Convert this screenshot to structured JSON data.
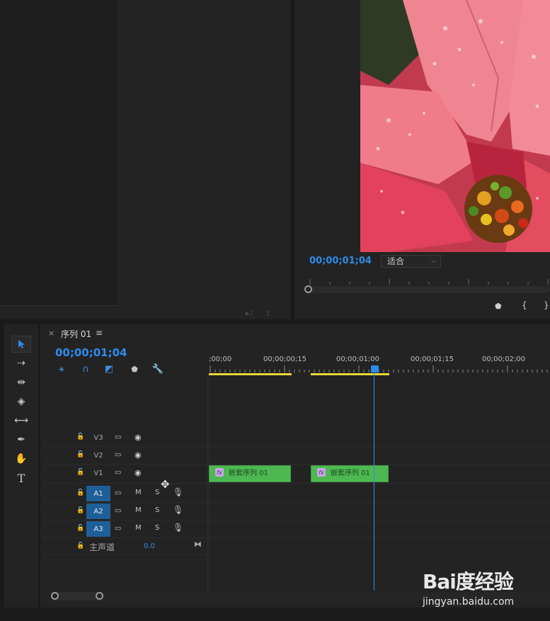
{
  "program_monitor": {
    "timecode": "00;00;01;04",
    "fit_select": {
      "value": "适合"
    }
  },
  "timeline": {
    "tab_title": "序列 01",
    "timecode": "00;00;01;04",
    "ruler_labels": [
      ";00;00",
      "00;00;00;15",
      "00;00;01;00",
      "00;00;01;15",
      "00;00;02;00"
    ],
    "video_tracks": [
      {
        "name": "V3"
      },
      {
        "name": "V2"
      },
      {
        "name": "V1"
      }
    ],
    "audio_tracks": [
      {
        "name": "A1",
        "mute": "M",
        "solo": "S"
      },
      {
        "name": "A2",
        "mute": "M",
        "solo": "S"
      },
      {
        "name": "A3",
        "mute": "M",
        "solo": "S"
      }
    ],
    "master": {
      "label": "主声道",
      "value": "0.0"
    },
    "clips": [
      {
        "label": "嵌套序列 01",
        "track": "V1"
      },
      {
        "label": "嵌套序列 01",
        "track": "V1"
      }
    ]
  },
  "watermark": {
    "brand": "Bai度经验",
    "sub": "jingyan.baidu.com"
  },
  "colors": {
    "accent": "#2d8ceb",
    "clip": "#4db852",
    "audio_track_label": "#1f5f98",
    "work_area": "#e8d63a"
  }
}
